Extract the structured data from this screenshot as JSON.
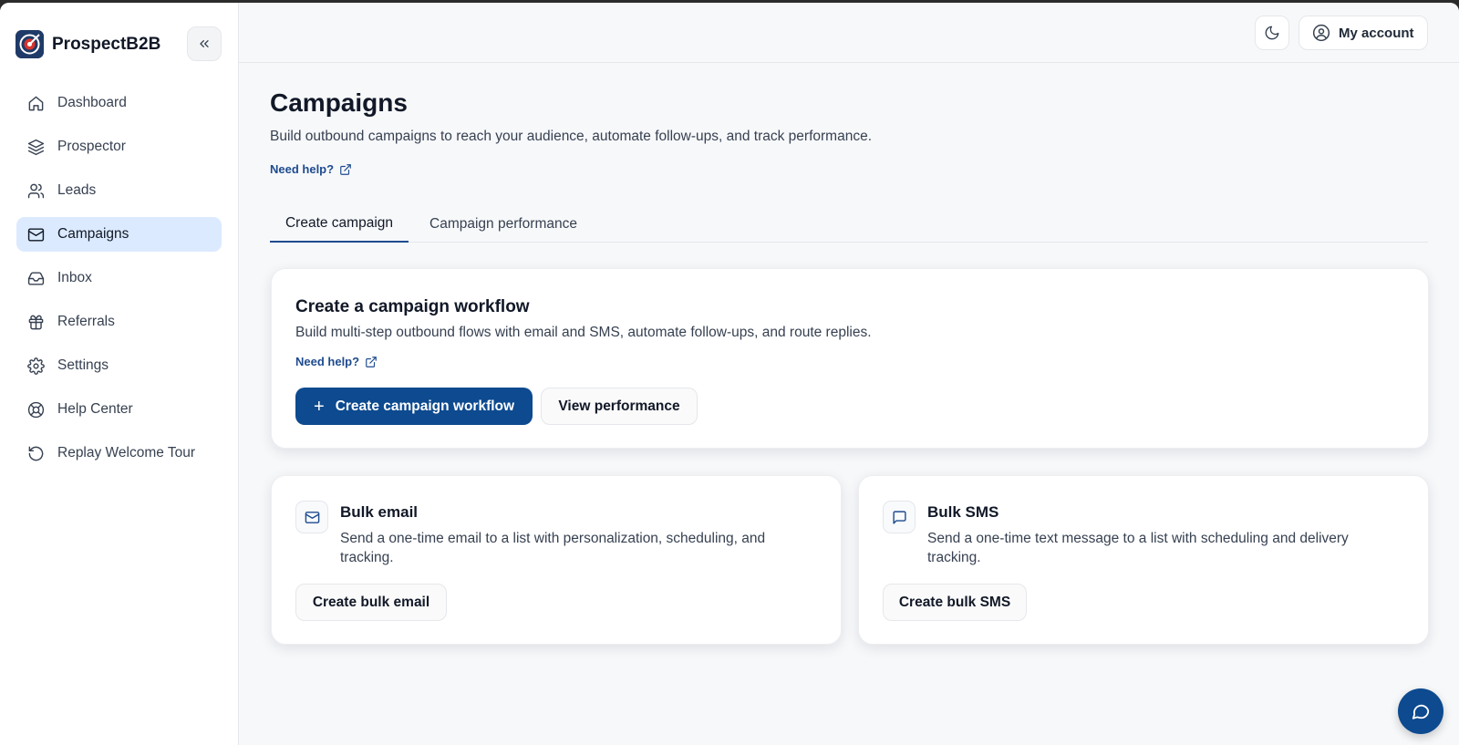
{
  "brand": {
    "name": "ProspectB2B",
    "logo_icon": "target-logo-icon",
    "accent": "#0d4a8f"
  },
  "sidebar": {
    "collapse_icon": "chevrons-left-icon",
    "items": [
      {
        "label": "Dashboard",
        "icon": "home-icon",
        "active": false
      },
      {
        "label": "Prospector",
        "icon": "layers-icon",
        "active": false
      },
      {
        "label": "Leads",
        "icon": "users-icon",
        "active": false
      },
      {
        "label": "Campaigns",
        "icon": "mail-icon",
        "active": true
      },
      {
        "label": "Inbox",
        "icon": "inbox-icon",
        "active": false
      },
      {
        "label": "Referrals",
        "icon": "gift-icon",
        "active": false
      },
      {
        "label": "Settings",
        "icon": "gear-icon",
        "active": false
      },
      {
        "label": "Help Center",
        "icon": "lifebuoy-icon",
        "active": false
      },
      {
        "label": "Replay Welcome Tour",
        "icon": "replay-icon",
        "active": false
      }
    ]
  },
  "topbar": {
    "theme_icon": "moon-icon",
    "account_label": "My account",
    "account_icon": "user-circle-icon"
  },
  "page": {
    "title": "Campaigns",
    "subtitle": "Build outbound campaigns to reach your audience, automate follow-ups, and track performance.",
    "help_label": "Need help?"
  },
  "tabs": [
    {
      "label": "Create campaign",
      "active": true
    },
    {
      "label": "Campaign performance",
      "active": false
    }
  ],
  "workflow_card": {
    "title": "Create a campaign workflow",
    "description": "Build multi-step outbound flows with email and SMS, automate follow-ups, and route replies.",
    "help_label": "Need help?",
    "primary_label": "Create campaign workflow",
    "secondary_label": "View performance"
  },
  "bulk_email": {
    "title": "Bulk email",
    "description": "Send a one-time email to a list with personalization, scheduling, and tracking.",
    "button_label": "Create bulk email",
    "icon": "mail-icon"
  },
  "bulk_sms": {
    "title": "Bulk SMS",
    "description": "Send a one-time text message to a list with scheduling and delivery tracking.",
    "button_label": "Create bulk SMS",
    "icon": "message-square-icon"
  },
  "chat": {
    "icon": "chat-bubble-icon"
  }
}
